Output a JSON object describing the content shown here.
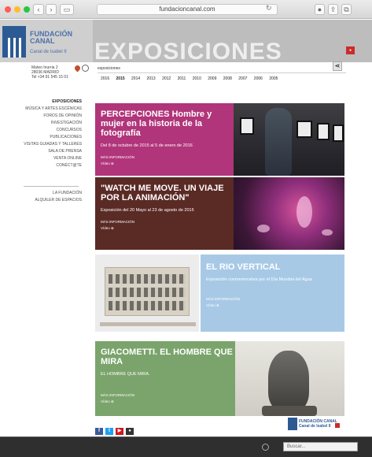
{
  "browser": {
    "url": "fundacioncanal.com",
    "colors": {
      "close": "#ff5f57",
      "minimize": "#febc2e",
      "zoom": "#28c840"
    }
  },
  "header": {
    "brand_line1": "FUNDACIÓN",
    "brand_line2": "CANAL",
    "brand_sub": "Canal de Isabel II",
    "page_title": "EXPOSICIONES"
  },
  "address": {
    "line1": "Mateo Inurria 2",
    "line2": "28036 MADRID",
    "line3": "Tel +34 91 545 15 01"
  },
  "breadcrumb": "exposiciones",
  "years": [
    "2016",
    "2015",
    "2014",
    "2013",
    "2012",
    "2011",
    "2010",
    "2009",
    "2008",
    "2007",
    "2006",
    "2005"
  ],
  "active_year": "2015",
  "sidebar": {
    "items": [
      "EXPOSICIONES",
      "MÚSICA Y ARTES ESCÉNICAS",
      "FOROS DE OPINIÓN",
      "INVESTIGACIÓN",
      "CONCURSOS",
      "PUBLICACIONES",
      "VISITAS GUIADAS Y TALLERES",
      "SALA DE PRENSA",
      "VENTA ONLINE",
      "CONÉCT@TE"
    ],
    "footer_items": [
      "LA FUNDACIÓN",
      "ALQUILER DE ESPACIOS"
    ]
  },
  "panels": [
    {
      "title": "PERCEPCIONES Hombre y mujer en la historia de la fotografía",
      "date": "Del 8 de octubre de 2015 al 5 de enero de 2016",
      "more": "MÁS INFORMACIÓN",
      "video": "Vídeo ⊕"
    },
    {
      "title": "\"WATCH ME MOVE. UN VIAJE POR LA ANIMACIÓN\"",
      "date": "Exposición del 20 Mayo al 23 de agosto de 2015",
      "more": "MÁS INFORMACIÓN",
      "video": "Vídeo ⊕"
    },
    {
      "title": "EL RIO VERTICAL",
      "date": "Exposición conmemorativa por el Día Mundial del Agua",
      "more": "MÁS INFORMACIÓN",
      "video": "Vídeo ⊕"
    },
    {
      "title": "GIACOMETTI. EL HOMBRE QUE MIRA",
      "date": "EL HOMBRE QUE MIRA.",
      "more": "MÁS INFORMACIÓN",
      "video": "Vídeo ⊕"
    }
  ],
  "footer": {
    "logo_text_1": "FUNDACIÓN CANAL",
    "logo_text_2": "Canal de Isabel II"
  },
  "bottombar": {
    "search_placeholder": "Buscar..."
  },
  "icons": {
    "share": "share-icon",
    "pin": "location-pin-icon",
    "clock": "clock-icon"
  }
}
